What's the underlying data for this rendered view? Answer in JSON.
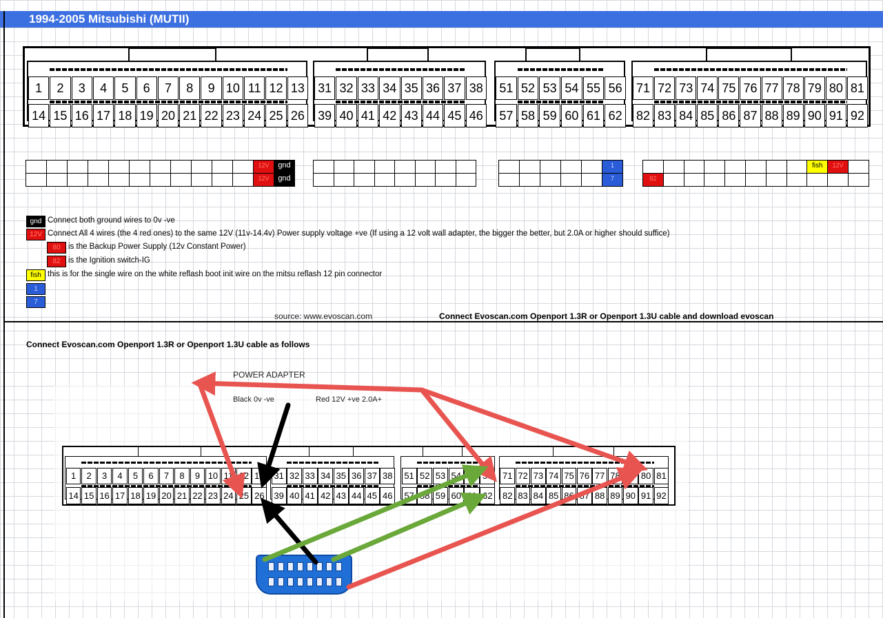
{
  "title": "1994-2005 Mitsubishi (MUTII)",
  "connector_top": {
    "row1": [
      "1",
      "2",
      "3",
      "4",
      "5",
      "6",
      "7",
      "8",
      "9",
      "10",
      "11",
      "12",
      "13",
      "31",
      "32",
      "33",
      "34",
      "35",
      "36",
      "37",
      "38",
      "51",
      "52",
      "53",
      "54",
      "55",
      "56",
      "71",
      "72",
      "73",
      "74",
      "75",
      "76",
      "77",
      "78",
      "79",
      "80",
      "81"
    ],
    "row2": [
      "14",
      "15",
      "16",
      "17",
      "18",
      "19",
      "20",
      "21",
      "22",
      "23",
      "24",
      "25",
      "26",
      "39",
      "40",
      "41",
      "42",
      "43",
      "44",
      "45",
      "46",
      "57",
      "58",
      "59",
      "60",
      "61",
      "62",
      "82",
      "83",
      "84",
      "85",
      "86",
      "87",
      "88",
      "89",
      "90",
      "91",
      "92"
    ]
  },
  "wiring_grid": {
    "gnd": "gnd",
    "v12": "12V",
    "fish": "fish",
    "k1": "1",
    "k7": "7",
    "p80": "80",
    "p82": "82"
  },
  "legend": {
    "gnd_label": "gnd",
    "gnd_text": "Connect both ground wires to 0v -ve",
    "v12_label": "12V",
    "v12_text": "Connect All 4 wires (the 4 red ones) to the same 12V (11v-14.4v)  Power supply voltage +ve  (If using a 12 volt wall adapter, the bigger the better, but 2.0A or higher should suffice)",
    "p80_label": "80",
    "p80_text": "is the Backup Power Supply (12v Constant Power)",
    "p82_label": "82",
    "p82_text": "is the Ignition switch-IG",
    "fish_label": "fish",
    "fish_text": "this is for the single wire on the white reflash boot init wire on the mitsu reflash 12 pin connector",
    "k1_label": "1",
    "k7_label": "7"
  },
  "source": "source: www.evoscan.com",
  "connect_heading": "Connect Evoscan.com Openport 1.3R  or Openport 1.3U cable and download evoscan",
  "section2_heading": "Connect Evoscan.com Openport 1.3R  or Openport 1.3U  cable as follows",
  "power_adapter": "POWER ADAPTER",
  "black_label": "Black 0v -ve",
  "red_label": "Red 12V +ve 2.0A+",
  "colors": {
    "title_bar": "#3c6fe0",
    "red": "#e11010",
    "blue": "#2a5cd8",
    "yellow": "#ffff00",
    "arrow_red": "#e85450",
    "arrow_green": "#6aa83a",
    "arrow_black": "#000000",
    "obd_blue": "#1f6fd6"
  }
}
